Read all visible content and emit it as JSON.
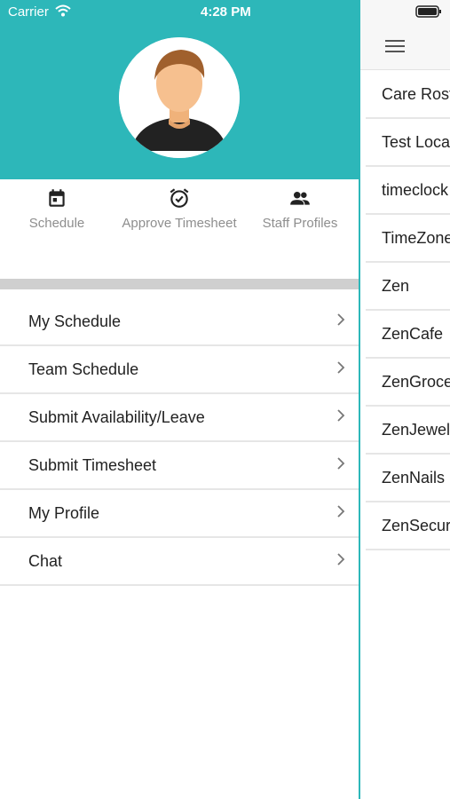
{
  "status_bar": {
    "carrier": "Carrier",
    "time": "4:28 PM"
  },
  "colors": {
    "accent": "#2db7b9",
    "separator": "#cfcfcf"
  },
  "quick_actions": [
    {
      "label": "Schedule",
      "icon": "calendar-icon"
    },
    {
      "label": "Approve Timesheet",
      "icon": "alarm-clock-check-icon"
    },
    {
      "label": "Staff Profiles",
      "icon": "people-icon"
    }
  ],
  "menu": [
    {
      "label": "My Schedule"
    },
    {
      "label": "Team Schedule"
    },
    {
      "label": "Submit Availability/Leave"
    },
    {
      "label": "Submit Timesheet"
    },
    {
      "label": "My Profile"
    },
    {
      "label": "Chat"
    }
  ],
  "locations": [
    {
      "label": "Care Rost"
    },
    {
      "label": "Test Loca"
    },
    {
      "label": "timeclock"
    },
    {
      "label": "TimeZone"
    },
    {
      "label": "Zen"
    },
    {
      "label": "ZenCafe"
    },
    {
      "label": "ZenGroce"
    },
    {
      "label": "ZenJewel"
    },
    {
      "label": "ZenNails"
    },
    {
      "label": "ZenSecur"
    }
  ]
}
